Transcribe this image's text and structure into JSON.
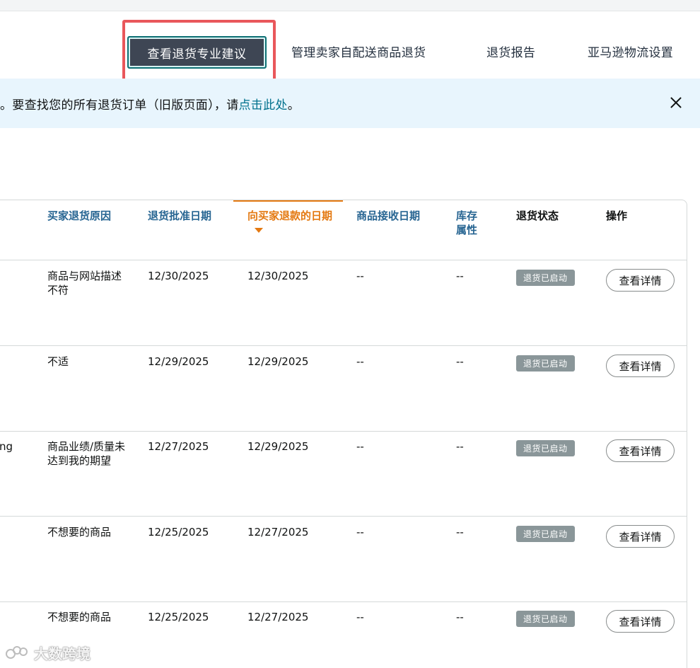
{
  "nav": {
    "active": "查看退货专业建议",
    "links": [
      "管理卖家自配送商品退货",
      "退货报告",
      "亚马逊物流设置"
    ]
  },
  "banner": {
    "text": "。要查找您的所有退货订单（旧版页面），请",
    "link": "点击此处",
    "suffix": "。"
  },
  "table": {
    "headers": {
      "reason": "买家退货原因",
      "approve": "退货批准日期",
      "refund": "向买家退款的日期",
      "receive": "商品接收日期",
      "inventory": "库存属性",
      "status": "退货状态",
      "action": "操作"
    },
    "rows": [
      {
        "left": "",
        "reason": "商品与网站描述不符",
        "approve": "12/30/2025",
        "refund": "12/30/2025",
        "receive": "--",
        "inventory": "--",
        "status": "退货已启动",
        "action": "查看详情"
      },
      {
        "left": "",
        "reason": "不适",
        "approve": "12/29/2025",
        "refund": "12/29/2025",
        "receive": "--",
        "inventory": "--",
        "status": "退货已启动",
        "action": "查看详情"
      },
      {
        "left": "ng",
        "reason": "商品业绩/质量未达到我的期望",
        "approve": "12/27/2025",
        "refund": "12/29/2025",
        "receive": "--",
        "inventory": "--",
        "status": "退货已启动",
        "action": "查看详情"
      },
      {
        "left": "",
        "reason": "不想要的商品",
        "approve": "12/25/2025",
        "refund": "12/27/2025",
        "receive": "--",
        "inventory": "--",
        "status": "退货已启动",
        "action": "查看详情"
      },
      {
        "left": "",
        "reason": "不想要的商品",
        "approve": "12/25/2025",
        "refund": "12/27/2025",
        "receive": "--",
        "inventory": "--",
        "status": "退货已启动",
        "action": "查看详情"
      }
    ]
  },
  "watermark": "大数跨境",
  "colors": {
    "accent": "#e47911",
    "link": "#276592",
    "highlight": "#e9575b",
    "badge": "#8a9699"
  }
}
